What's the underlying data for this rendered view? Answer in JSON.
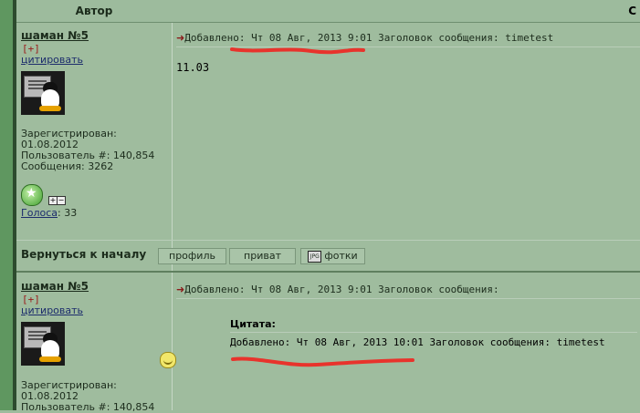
{
  "header": {
    "author_col": "Автор",
    "message_col_partial": "С"
  },
  "posts": [
    {
      "username": "шаман №5",
      "plus": "[+]",
      "quote_link": "цитировать",
      "registered": "Зарегистрирован: 01.08.2012",
      "user_num": "Пользователь #: 140,854",
      "messages": "Сообщения: 3262",
      "votes_label": "Голоса",
      "votes_value": ": 33",
      "msg_header": "Добавлено: Чт 08 Авг, 2013 9:01   Заголовок сообщения: timetest",
      "body": "11.03",
      "footer": {
        "back_to_top": "Вернуться к началу",
        "profile_btn": "профиль",
        "private_btn": "приват",
        "photos_btn": "фотки",
        "jpg_icon_text": "JPG"
      }
    },
    {
      "username": "шаман №5",
      "plus": "[+]",
      "quote_link": "цитировать",
      "registered": "Зарегистрирован: 01.08.2012",
      "user_num": "Пользователь #: 140,854",
      "msg_header": "Добавлено: Чт 08 Авг, 2013 9:01   Заголовок сообщения:",
      "quote_title": "Цитата:",
      "quote_text": "Добавлено: Чт 08 Авг, 2013 10:01 Заголовок сообщения: timetest"
    }
  ],
  "colors": {
    "accent_red": "#e8332c",
    "bg_green": "#9dbb9d",
    "left_bar": "#5f9760"
  }
}
